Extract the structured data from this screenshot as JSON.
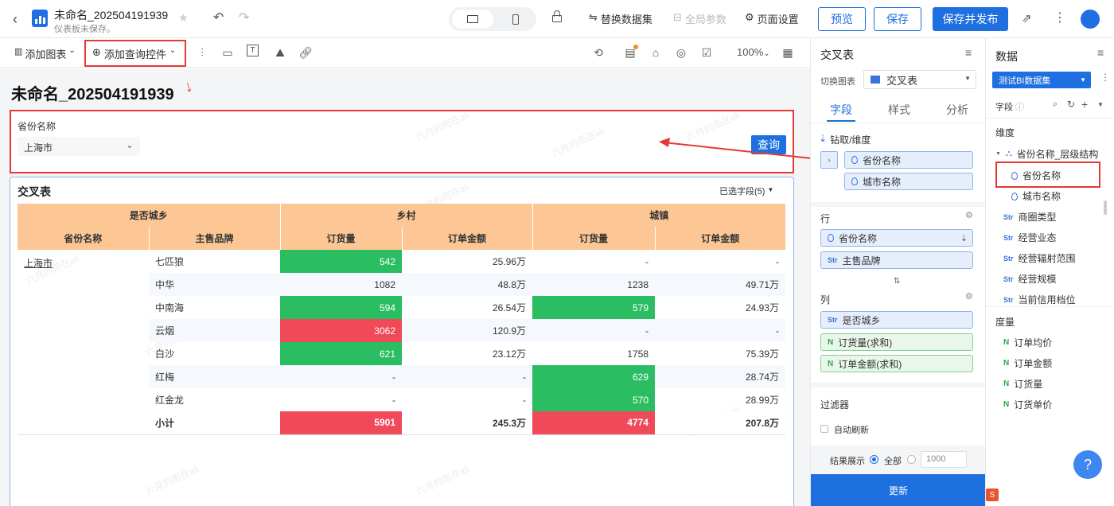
{
  "header": {
    "title": "未命名_202504191939",
    "subtitle": "仪表板未保存。",
    "replace_dataset": "替换数据集",
    "global_params": "全局参数",
    "page_settings": "页面设置",
    "preview": "预览",
    "save": "保存",
    "save_publish": "保存并发布"
  },
  "toolbar": {
    "add_chart": "添加图表",
    "add_query_control": "添加查询控件",
    "zoom": "100%"
  },
  "dashboard": {
    "title": "未命名_202504191939",
    "query_label": "省份名称",
    "query_value": "上海市",
    "query_button": "查询",
    "watermark": "六月的雨在ali"
  },
  "cross_table": {
    "title": "交叉表",
    "selected_fields": "已选字段(5)",
    "header_row1": [
      "是否城乡",
      "乡村",
      "城镇"
    ],
    "header_row2": [
      "省份名称",
      "主售品牌",
      "订货量",
      "订单金额",
      "订货量",
      "订单金额"
    ],
    "province": "上海市",
    "rows": [
      {
        "brand": "七匹狼",
        "c1": "542",
        "c2": "25.96万",
        "c3": "-",
        "c4": "-"
      },
      {
        "brand": "中华",
        "c1": "1082",
        "c2": "48.8万",
        "c3": "1238",
        "c4": "49.71万"
      },
      {
        "brand": "中南海",
        "c1": "594",
        "c2": "26.54万",
        "c3": "579",
        "c4": "24.93万"
      },
      {
        "brand": "云烟",
        "c1": "3062",
        "c2": "120.9万",
        "c3": "-",
        "c4": "-"
      },
      {
        "brand": "白沙",
        "c1": "621",
        "c2": "23.12万",
        "c3": "1758",
        "c4": "75.39万"
      },
      {
        "brand": "红梅",
        "c1": "-",
        "c2": "-",
        "c3": "629",
        "c4": "28.74万"
      },
      {
        "brand": "红金龙",
        "c1": "-",
        "c2": "-",
        "c3": "570",
        "c4": "28.99万"
      }
    ],
    "subtotal": {
      "label": "小计",
      "c1": "5901",
      "c2": "245.3万",
      "c3": "4774",
      "c4": "207.8万"
    }
  },
  "config_panel": {
    "title": "交叉表",
    "switch_chart_label": "切换图表",
    "chart_type": "交叉表",
    "tabs": [
      "字段",
      "样式",
      "分析"
    ],
    "drill_label": "钻取/维度",
    "drill_fields": [
      "省份名称",
      "城市名称"
    ],
    "row_label": "行",
    "row_fields": [
      "省份名称",
      "主售品牌"
    ],
    "col_label": "列",
    "col_fields": [
      "是否城乡",
      "订货量(求和)",
      "订单金额(求和)"
    ],
    "filter_label": "过滤器",
    "auto_refresh": "自动刷新",
    "result_label": "结果展示",
    "result_all": "全部",
    "result_limit": "1000",
    "update_button": "更新"
  },
  "data_panel": {
    "title": "数据",
    "dataset": "测试BI数据集",
    "fields_label": "字段",
    "dimension_label": "维度",
    "hierarchy": "省份名称_层级结构",
    "hierarchy_fields": [
      "省份名称",
      "城市名称"
    ],
    "dimensions": [
      "商圈类型",
      "经营业态",
      "经营辐射范围",
      "经营规模",
      "当前信用档位"
    ],
    "measure_label": "度量",
    "measures": [
      "订单均价",
      "订单金额",
      "订货量",
      "订货单价"
    ]
  },
  "colors": {
    "accent": "#1e6fe0",
    "header_orange": "#fcc794",
    "green_cell": "#2bbd62",
    "red_cell": "#f04a5a",
    "annotation_red": "#e53935"
  }
}
